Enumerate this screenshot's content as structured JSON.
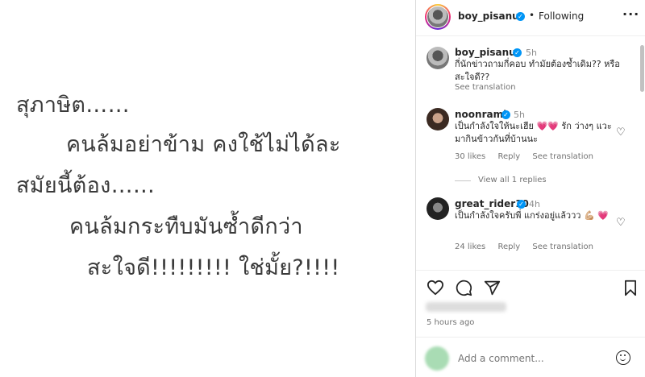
{
  "post": {
    "lines": [
      "สุภาษิต……",
      "คนล้มอย่าข้าม คงใช้ไม่ได้ละ",
      "สมัยนี้ต้อง……",
      "คนล้มกระทืบมันซ้ำดีกว่า",
      "สะใจดี!!!!!!!!! ใช่มั้ย?!!!!"
    ]
  },
  "header": {
    "username": "boy_pisanu",
    "separator": "•",
    "following_label": "Following",
    "more_icon": "more-horizontal-icon"
  },
  "caption": {
    "username": "boy_pisanu",
    "time": "5h",
    "text": "กี่นักข่าวถามกี่คอบ ทำมัยต้องซ้ำเดิม?? หรือ สะใจดี??",
    "see_translation": "See translation"
  },
  "comments": [
    {
      "username": "noonrami",
      "time": "5h",
      "text": "เป็นกำลังใจให้นะเฮีย 💗💗 รัก ว่างๆ แวะมากินข้าวกันที่บ้านนะ",
      "likes": "30 likes",
      "reply": "Reply",
      "see_translation": "See translation",
      "view_replies": "View all 1 replies"
    },
    {
      "username": "great_rider10",
      "time": "4h",
      "text": "เป็นกำลังใจครับพี่ แกร่งอยู่แล้ววว 💪🏼 💗",
      "likes": "24 likes",
      "reply": "Reply",
      "see_translation": "See translation"
    }
  ],
  "footer": {
    "posted_time": "5 hours ago",
    "add_comment_placeholder": "Add a comment...",
    "icons": [
      "heart-icon",
      "comment-icon",
      "share-icon",
      "save-icon",
      "emoji-icon"
    ]
  },
  "colors": {
    "verified": "#0095f6",
    "secondary_text": "#737373",
    "heart": "#ed4956"
  }
}
